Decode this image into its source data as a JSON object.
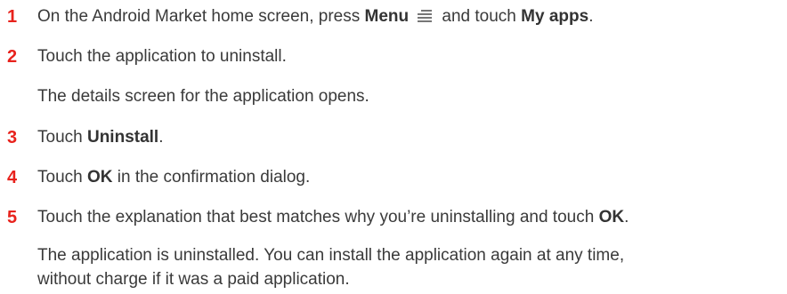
{
  "steps": [
    {
      "number": "1",
      "parts": {
        "a": "On the Android Market home screen, press ",
        "b": "Menu",
        "c": " and touch ",
        "d": "My apps",
        "e": "."
      },
      "icon": "menu-icon"
    },
    {
      "number": "2",
      "text": "Touch the application to uninstall.",
      "note": "The details screen for the application opens."
    },
    {
      "number": "3",
      "parts": {
        "a": "Touch ",
        "b": "Uninstall",
        "c": "."
      }
    },
    {
      "number": "4",
      "parts": {
        "a": "Touch ",
        "b": "OK",
        "c": " in the confirmation dialog."
      }
    },
    {
      "number": "5",
      "parts": {
        "a": "Touch the explanation that best matches why you’re uninstalling and touch ",
        "b": "OK",
        "c": "."
      },
      "note_line1": "The application is uninstalled. You can install the application again at any time,",
      "note_line2": "without charge if it was a paid application."
    }
  ],
  "colors": {
    "number": "#e8221c",
    "text": "#3a3a3a"
  }
}
